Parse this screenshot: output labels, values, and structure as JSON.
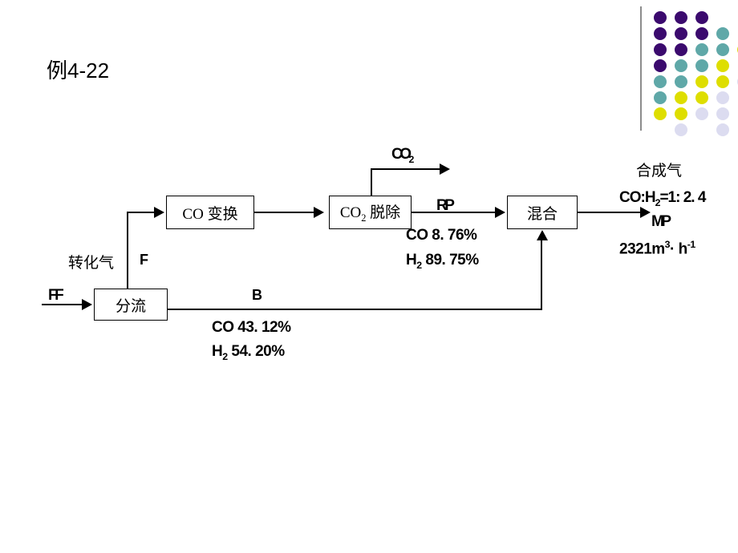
{
  "slide": {
    "title": "例4-22",
    "background": "#ffffff"
  },
  "decoration": {
    "name": "dot-grid-ornament",
    "rule_color": "#8c8c8c",
    "palette": {
      "purple": "#3b0a6e",
      "teal": "#5fa8a8",
      "yellow": "#dede00",
      "lavender": "#dcdcf0"
    },
    "dots": [
      {
        "col": 0,
        "row": 0,
        "color": "#3b0a6e"
      },
      {
        "col": 1,
        "row": 0,
        "color": "#3b0a6e"
      },
      {
        "col": 2,
        "row": 0,
        "color": "#3b0a6e"
      },
      {
        "col": 0,
        "row": 1,
        "color": "#3b0a6e"
      },
      {
        "col": 1,
        "row": 1,
        "color": "#3b0a6e"
      },
      {
        "col": 2,
        "row": 1,
        "color": "#3b0a6e"
      },
      {
        "col": 3,
        "row": 1,
        "color": "#5fa8a8"
      },
      {
        "col": 0,
        "row": 2,
        "color": "#3b0a6e"
      },
      {
        "col": 1,
        "row": 2,
        "color": "#3b0a6e"
      },
      {
        "col": 2,
        "row": 2,
        "color": "#5fa8a8"
      },
      {
        "col": 3,
        "row": 2,
        "color": "#5fa8a8"
      },
      {
        "col": 4,
        "row": 2,
        "color": "#dede00"
      },
      {
        "col": 0,
        "row": 3,
        "color": "#3b0a6e"
      },
      {
        "col": 1,
        "row": 3,
        "color": "#5fa8a8"
      },
      {
        "col": 2,
        "row": 3,
        "color": "#5fa8a8"
      },
      {
        "col": 3,
        "row": 3,
        "color": "#dede00"
      },
      {
        "col": 0,
        "row": 4,
        "color": "#5fa8a8"
      },
      {
        "col": 1,
        "row": 4,
        "color": "#5fa8a8"
      },
      {
        "col": 2,
        "row": 4,
        "color": "#dede00"
      },
      {
        "col": 3,
        "row": 4,
        "color": "#dede00"
      },
      {
        "col": 4,
        "row": 4,
        "color": "#dcdcf0"
      },
      {
        "col": 0,
        "row": 5,
        "color": "#5fa8a8"
      },
      {
        "col": 1,
        "row": 5,
        "color": "#dede00"
      },
      {
        "col": 2,
        "row": 5,
        "color": "#dede00"
      },
      {
        "col": 3,
        "row": 5,
        "color": "#dcdcf0"
      },
      {
        "col": 0,
        "row": 6,
        "color": "#dede00"
      },
      {
        "col": 1,
        "row": 6,
        "color": "#dede00"
      },
      {
        "col": 2,
        "row": 6,
        "color": "#dcdcf0"
      },
      {
        "col": 3,
        "row": 6,
        "color": "#dcdcf0"
      },
      {
        "col": 1,
        "row": 7,
        "color": "#dcdcf0"
      },
      {
        "col": 3,
        "row": 7,
        "color": "#dcdcf0"
      }
    ]
  },
  "flowchart": {
    "units": {
      "splitter": "分流",
      "co_shift": "CO 变换",
      "co2_removal": "CO₂ 脱除",
      "mixer": "混合"
    },
    "streams": {
      "feed_label": "FF",
      "converted_gas_label": "转化气",
      "f_label": "F",
      "b_label": "B",
      "rp_label": "RP",
      "mp_label": "MP",
      "co2_vent_label": "CO₂"
    },
    "compositions": {
      "rp_co": "CO 8. 76%",
      "rp_h2": "H₂ 89. 75%",
      "b_co": "CO 43. 12%",
      "b_h2": "H₂   54. 20%"
    },
    "product": {
      "name": "合成气",
      "ratio": "CO:H₂=1: 2. 4",
      "flow": "2321m³· h⁻¹"
    }
  }
}
